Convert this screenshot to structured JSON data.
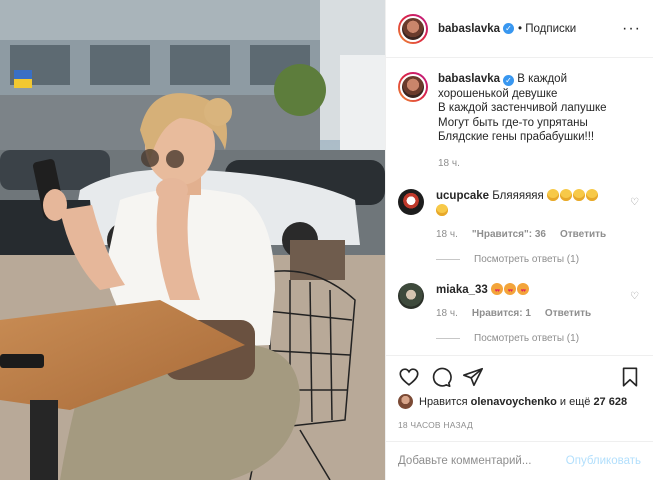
{
  "post": {
    "username": "babaslavka",
    "follow_label": "• Подписки",
    "more_icon": "more-dots-icon",
    "caption_lines": [
      "В каждой",
      "хорошенькой девушке",
      "В каждой застенчивой лапушке",
      "Могут быть где-то упрятаны",
      "Блядские гены прабабушки!!!"
    ],
    "caption_time": "18 ч."
  },
  "comments": [
    {
      "username": "ucupcake",
      "text": "Бляяяяяя",
      "emojis": [
        "laugh",
        "laugh",
        "laugh",
        "laugh",
        "laugh"
      ],
      "time": "18 ч.",
      "likes_label": "\"Нравится\": 36",
      "reply_label": "Ответить",
      "view_replies": "Посмотреть ответы (1)"
    },
    {
      "username": "miaka_33",
      "text": "",
      "emojis": [
        "love",
        "love",
        "love"
      ],
      "time": "18 ч.",
      "likes_label": "Нравится: 1",
      "reply_label": "Ответить",
      "view_replies": "Посмотреть ответы (1)"
    }
  ],
  "likes": {
    "prefix": "Нравится",
    "user": "olenavoychenko",
    "and": "и ещё",
    "count": "27 628"
  },
  "timestamp": "18 ЧАСОВ НАЗАД",
  "add_comment": {
    "placeholder": "Добавьте комментарий...",
    "publish_label": "Опубликовать"
  },
  "colors": {
    "verified": "#3897f0",
    "publish_disabled": "#b2dffc",
    "muted": "#8e8e8e"
  }
}
